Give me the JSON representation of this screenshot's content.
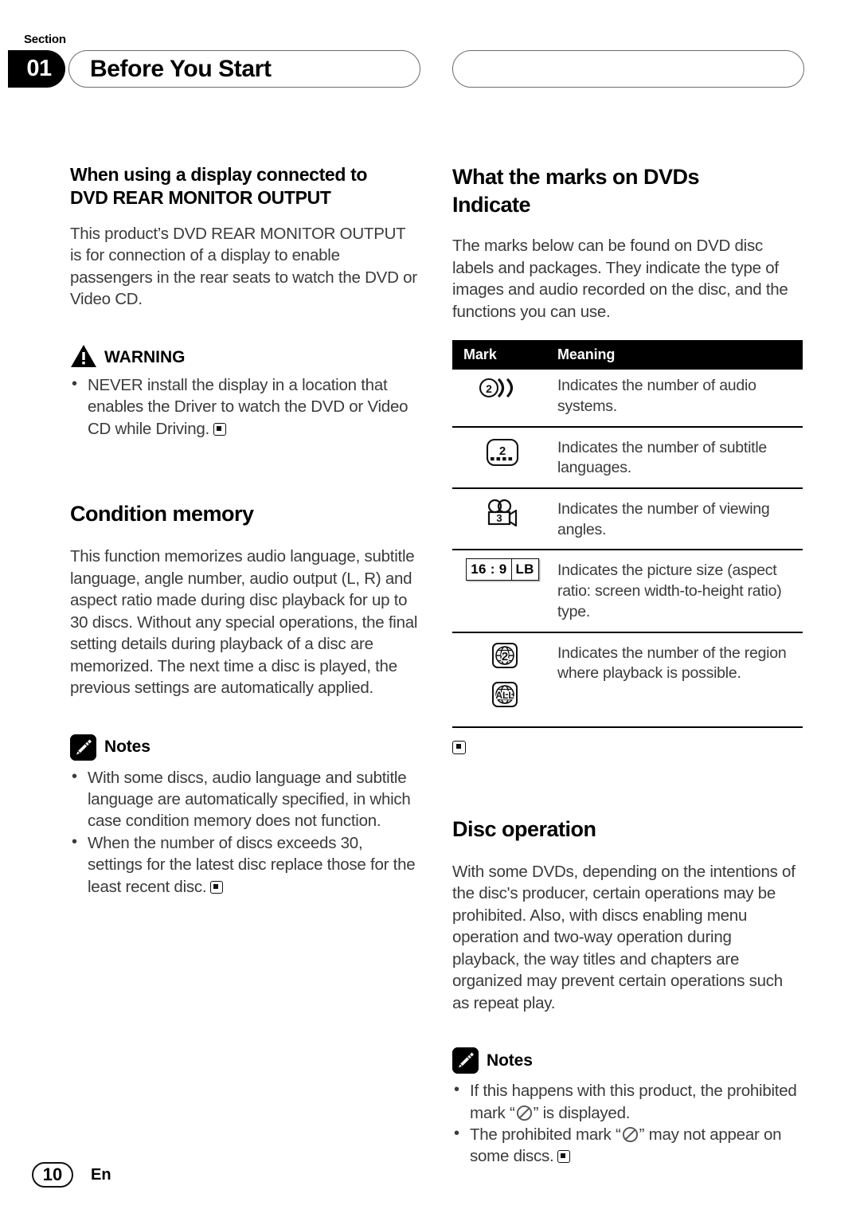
{
  "header": {
    "section_word": "Section",
    "section_number": "01",
    "title": "Before You Start"
  },
  "left_column": {
    "heading_line1": "When using a display connected to",
    "heading_line2": "DVD REAR MONITOR OUTPUT",
    "intro_paragraph": "This product’s DVD REAR MONITOR OUTPUT is for connection of a display to enable passengers in the rear seats to watch the DVD or Video CD.",
    "warning": {
      "label": "WARNING",
      "icon": "warning-triangle-icon",
      "bullets": [
        "NEVER install the display in a location that enables the Driver to watch the DVD or Video CD while Driving."
      ]
    },
    "condition_memory": {
      "heading": "Condition memory",
      "paragraph": "This function memorizes audio language, subtitle language, angle number, audio output (L, R) and aspect ratio made during disc playback for up to 30 discs. Without any special operations, the final setting details during playback of a disc are memorized. The next time a disc is played, the previous settings are automatically applied."
    },
    "notes": {
      "label": "Notes",
      "icon": "pencil-icon",
      "bullets": [
        "With some discs, audio language and subtitle language are automatically specified, in which case condition memory does not function.",
        "When the number of discs exceeds 30, settings for the latest disc replace those for the least recent disc."
      ]
    }
  },
  "right_column": {
    "marks_section": {
      "heading_line1": "What the marks on DVDs",
      "heading_line2": "Indicate",
      "paragraph": "The marks below can be found on DVD disc labels and packages. They indicate the type of images and audio recorded on the disc, and the functions you can use."
    },
    "marks_table": {
      "columns": [
        "Mark",
        "Meaning"
      ],
      "rows": [
        {
          "icon": "audio-systems-icon",
          "icon_value": "2",
          "meaning": "Indicates the number of audio systems."
        },
        {
          "icon": "subtitle-languages-icon",
          "icon_value": "2",
          "meaning": "Indicates the number of subtitle languages."
        },
        {
          "icon": "viewing-angles-camera-icon",
          "icon_value": "3",
          "meaning": "Indicates the number of viewing angles."
        },
        {
          "icon": "aspect-ratio-icon",
          "icon_value_left": "16 : 9",
          "icon_value_right": "LB",
          "meaning": "Indicates the picture size (aspect ratio: screen width-to-height ratio) type."
        },
        {
          "icon": "region-globe-icon",
          "icon_value": "2",
          "icon_value_2": "ALL",
          "meaning": "Indicates the number of the region where playback is possible."
        }
      ]
    },
    "disc_operation": {
      "heading": "Disc operation",
      "paragraph": "With some DVDs, depending on the intentions of the disc's producer, certain operations may be prohibited. Also, with discs enabling menu operation and two-way operation during playback, the way titles and chapters are organized may prevent certain operations such as repeat play."
    },
    "notes": {
      "label": "Notes",
      "icon": "pencil-icon",
      "bullets": [
        {
          "before": "If this happens with this product, the prohibited mark “",
          "after": "” is displayed."
        },
        {
          "before": "The prohibited mark “",
          "after": "” may not appear on some discs."
        }
      ]
    }
  },
  "footer": {
    "page_number": "10",
    "language": "En"
  },
  "colors": {
    "text": "#3b3b3b",
    "heading": "#000000",
    "rule": "#000000",
    "pill_border": "#6d6d6d"
  }
}
